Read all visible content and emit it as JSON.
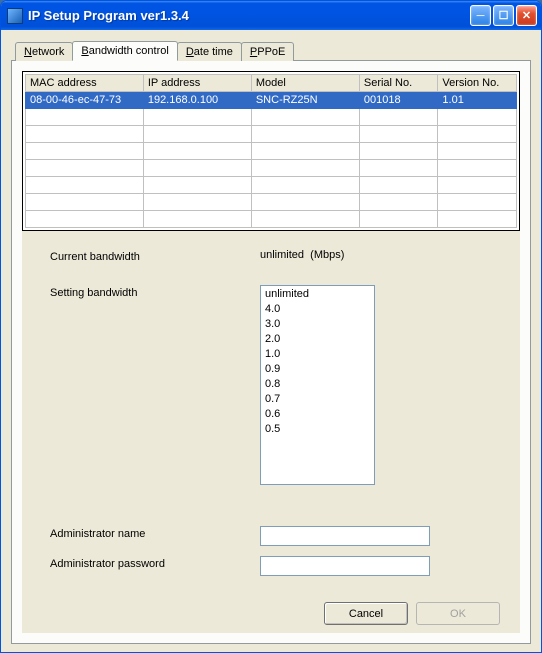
{
  "window": {
    "title": "IP Setup Program ver1.3.4"
  },
  "tabs": [
    {
      "label": "Network",
      "underline": "N"
    },
    {
      "label": "Bandwidth control",
      "underline": "B"
    },
    {
      "label": "Date time",
      "underline": "D"
    },
    {
      "label": "PPPoE",
      "underline": "P"
    }
  ],
  "active_tab": 1,
  "table": {
    "headers": [
      "MAC address",
      "IP address",
      "Model",
      "Serial No.",
      "Version No."
    ],
    "rows": [
      {
        "cells": [
          "08-00-46-ec-47-73",
          "192.168.0.100",
          "SNC-RZ25N",
          "001018",
          "1.01"
        ],
        "selected": true
      }
    ],
    "empty_rows": 7
  },
  "bandwidth": {
    "current_label": "Current bandwidth",
    "current_value": "unlimited",
    "current_unit": "(Mbps)",
    "setting_label": "Setting bandwidth",
    "options": [
      "unlimited",
      "4.0",
      "3.0",
      "2.0",
      "1.0",
      "0.9",
      "0.8",
      "0.7",
      "0.6",
      "0.5"
    ]
  },
  "admin": {
    "name_label": "Administrator name",
    "password_label": "Administrator password",
    "name_value": "",
    "password_value": ""
  },
  "buttons": {
    "cancel": "Cancel",
    "ok": "OK"
  }
}
